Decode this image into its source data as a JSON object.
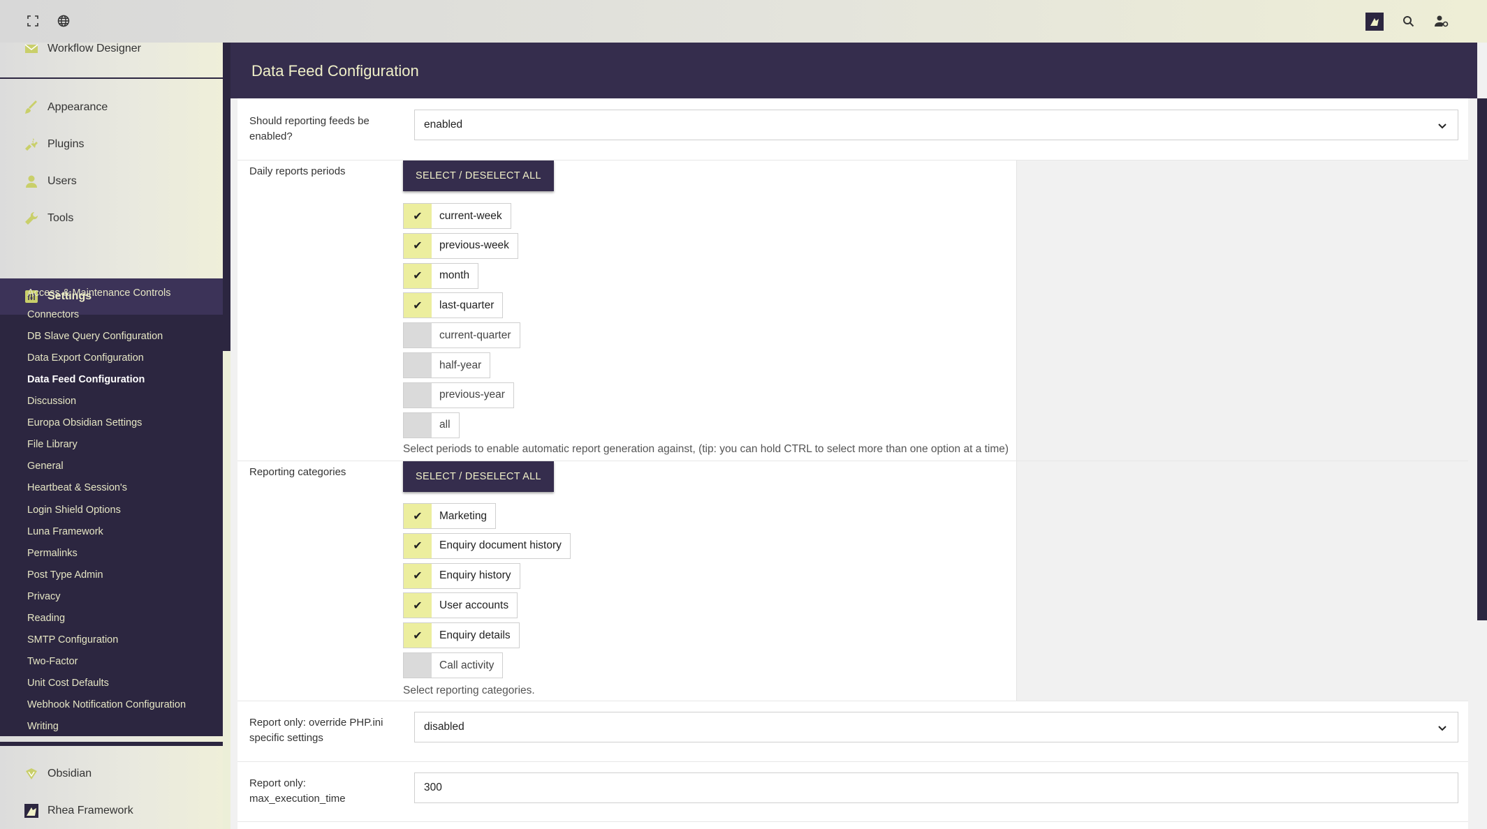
{
  "topbar": {
    "fullscreen_icon": "fullscreen-icon",
    "globe_icon": "globe-icon",
    "brand_icon": "brand-logo-icon",
    "search_icon": "search-icon",
    "user_icon": "user-settings-icon"
  },
  "sidebar": {
    "workflow": "Workflow Designer",
    "appearance": "Appearance",
    "plugins": "Plugins",
    "users": "Users",
    "tools": "Tools",
    "settings": "Settings",
    "sub": [
      "Access & Maintenance Controls",
      "Connectors",
      "DB Slave Query Configuration",
      "Data Export Configuration",
      "Data Feed Configuration",
      "Discussion",
      "Europa Obsidian Settings",
      "File Library",
      "General",
      "Heartbeat & Session's",
      "Login Shield Options",
      "Luna Framework",
      "Permalinks",
      "Post Type Admin",
      "Privacy",
      "Reading",
      "SMTP Configuration",
      "Two-Factor",
      "Unit Cost Defaults",
      "Webhook Notification Configuration",
      "Writing"
    ],
    "obsidian": "Obsidian",
    "rhea": "Rhea Framework",
    "accent": "#f0f0c8"
  },
  "main": {
    "title": "Data Feed Configuration",
    "feeds_label": "Should reporting feeds be enabled?",
    "feeds_value": "enabled",
    "periods_label": "Daily reports periods",
    "select_all": "SELECT / DESELECT ALL",
    "periods": [
      {
        "label": "current-week",
        "checked": true
      },
      {
        "label": "previous-week",
        "checked": true
      },
      {
        "label": "month",
        "checked": true
      },
      {
        "label": "last-quarter",
        "checked": true
      },
      {
        "label": "current-quarter",
        "checked": false
      },
      {
        "label": "half-year",
        "checked": false
      },
      {
        "label": "previous-year",
        "checked": false
      },
      {
        "label": "all",
        "checked": false
      }
    ],
    "periods_help": "Select periods to enable automatic report generation against, (tip: you can hold CTRL to select more than one option at a time)",
    "categories_label": "Reporting categories",
    "categories": [
      {
        "label": "Marketing",
        "checked": true
      },
      {
        "label": "Enquiry document history",
        "checked": true
      },
      {
        "label": "Enquiry history",
        "checked": true
      },
      {
        "label": "User accounts",
        "checked": true
      },
      {
        "label": "Enquiry details",
        "checked": true
      },
      {
        "label": "Call activity",
        "checked": false
      }
    ],
    "categories_help": "Select reporting categories.",
    "override_label": "Report only: override PHP.ini specific settings",
    "override_value": "disabled",
    "exec_label": "Report only: max_execution_time",
    "exec_value": "300",
    "check_glyph": "✔"
  }
}
